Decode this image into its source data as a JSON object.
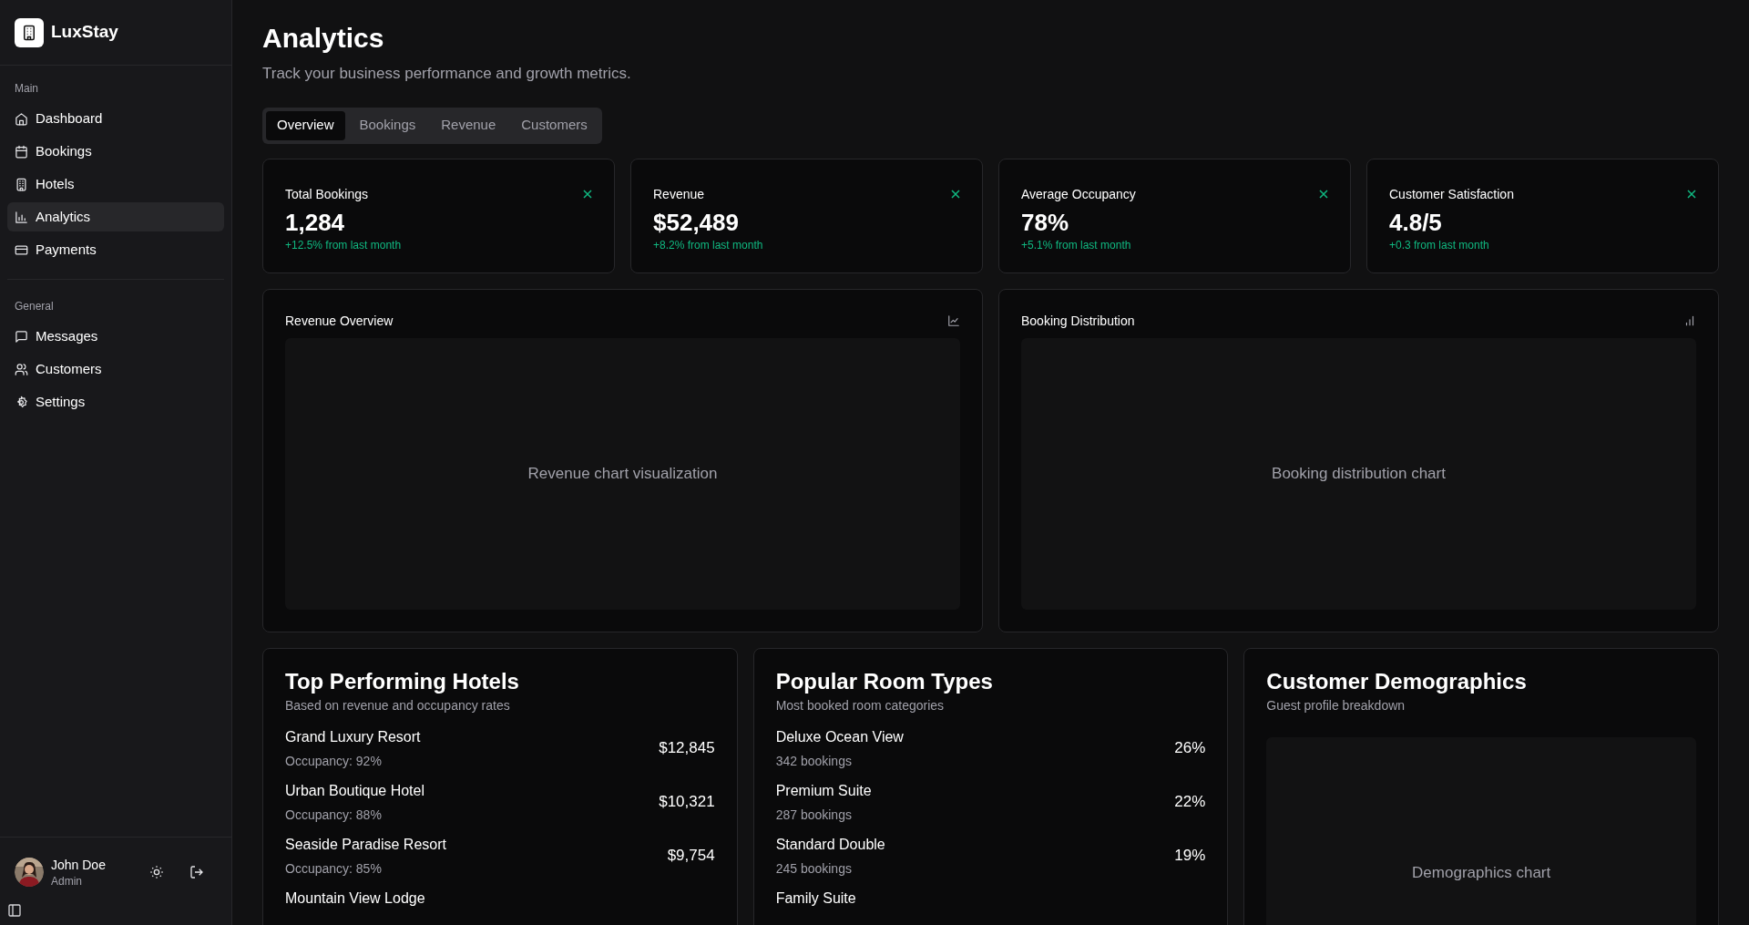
{
  "brand": {
    "name": "LuxStay"
  },
  "sidebar": {
    "sections": [
      {
        "label": "Main",
        "items": [
          {
            "label": "Dashboard",
            "selected": false
          },
          {
            "label": "Bookings",
            "selected": false
          },
          {
            "label": "Hotels",
            "selected": false
          },
          {
            "label": "Analytics",
            "selected": true
          },
          {
            "label": "Payments",
            "selected": false
          }
        ]
      },
      {
        "label": "General",
        "items": [
          {
            "label": "Messages",
            "selected": false
          },
          {
            "label": "Customers",
            "selected": false
          },
          {
            "label": "Settings",
            "selected": false
          }
        ]
      }
    ],
    "user": {
      "name": "John Doe",
      "role": "Admin"
    }
  },
  "page": {
    "title": "Analytics",
    "subtitle": "Track your business performance and growth metrics."
  },
  "tabs": [
    {
      "label": "Overview",
      "selected": true
    },
    {
      "label": "Bookings",
      "selected": false
    },
    {
      "label": "Revenue",
      "selected": false
    },
    {
      "label": "Customers",
      "selected": false
    }
  ],
  "stats": [
    {
      "label": "Total Bookings",
      "value": "1,284",
      "change": "+12.5% from last month"
    },
    {
      "label": "Revenue",
      "value": "$52,489",
      "change": "+8.2% from last month"
    },
    {
      "label": "Average Occupancy",
      "value": "78%",
      "change": "+5.1% from last month"
    },
    {
      "label": "Customer Satisfaction",
      "value": "4.8/5",
      "change": "+0.3 from last month"
    }
  ],
  "chart_panels": [
    {
      "title": "Revenue Overview",
      "placeholder": "Revenue chart visualization"
    },
    {
      "title": "Booking Distribution",
      "placeholder": "Booking distribution chart"
    }
  ],
  "lists": [
    {
      "kind": "list",
      "title": "Top Performing Hotels",
      "subtitle": "Based on revenue and occupancy rates",
      "rows": [
        {
          "name": "Grand Luxury Resort",
          "detail": "Occupancy: 92%",
          "value": "$12,845"
        },
        {
          "name": "Urban Boutique Hotel",
          "detail": "Occupancy: 88%",
          "value": "$10,321"
        },
        {
          "name": "Seaside Paradise Resort",
          "detail": "Occupancy: 85%",
          "value": "$9,754"
        },
        {
          "name": "Mountain View Lodge"
        }
      ]
    },
    {
      "kind": "list",
      "title": "Popular Room Types",
      "subtitle": "Most booked room categories",
      "rows": [
        {
          "name": "Deluxe Ocean View",
          "detail": "342 bookings",
          "value": "26%"
        },
        {
          "name": "Premium Suite",
          "detail": "287 bookings",
          "value": "22%"
        },
        {
          "name": "Standard Double",
          "detail": "245 bookings",
          "value": "19%"
        },
        {
          "name": "Family Suite"
        }
      ]
    },
    {
      "kind": "placeholder",
      "title": "Customer Demographics",
      "subtitle": "Guest profile breakdown",
      "placeholder": "Demographics chart"
    }
  ]
}
